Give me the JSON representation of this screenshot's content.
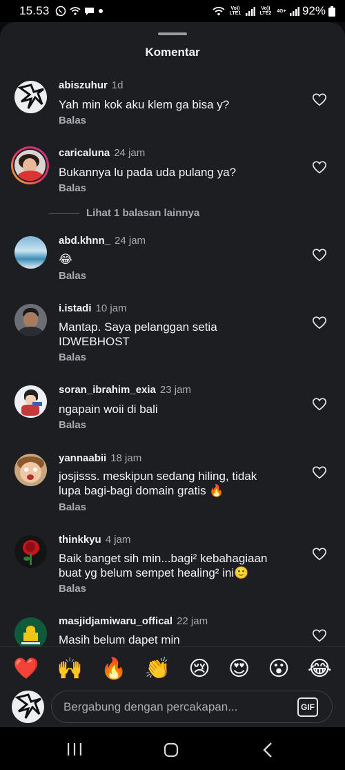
{
  "status": {
    "time": "15.53",
    "battery": "92%",
    "sim1": "Vo)) LTE1",
    "sim2": "Vo)) LTE2",
    "net": "4G+"
  },
  "sheet": {
    "title": "Komentar"
  },
  "reply_label": "Balas",
  "more_replies": "Lihat 1 balasan lainnya",
  "comments": [
    {
      "user": "abiszuhur",
      "time": "1d",
      "text": "Yah min kok aku klem ga bisa y?"
    },
    {
      "user": "caricaluna",
      "time": "24 jam",
      "text": "Bukannya lu pada uda pulang ya?"
    },
    {
      "user": "abd.khnn_",
      "time": "24 jam",
      "text": "😂"
    },
    {
      "user": "i.istadi",
      "time": "10 jam",
      "text": "Mantap. Saya pelanggan setia\nIDWEBHOST"
    },
    {
      "user": "soran_ibrahim_exia",
      "time": "23 jam",
      "text": "ngapain woii di bali"
    },
    {
      "user": "yannaabii",
      "time": "18 jam",
      "text": "josjisss. meskipun sedang hiling, tidak\nlupa bagi-bagi domain gratis 🔥"
    },
    {
      "user": "thinkkyu",
      "time": "4 jam",
      "text": "Baik banget sih min...bagi² kebahagiaan\nbuat yg belum sempet healing² ini🙂"
    },
    {
      "user": "masjidjamiwaru_offical",
      "time": "22 jam",
      "text": "Masih belum dapet min"
    }
  ],
  "emoji_reactions": [
    "❤️",
    "🙌",
    "🔥",
    "👏",
    "😢",
    "😍",
    "😮",
    "😂"
  ],
  "composer": {
    "placeholder": "Bergabung dengan percakapan...",
    "gif_label": "GIF"
  },
  "colors": {
    "sheet_bg": "#1c1e22",
    "text": "#f2f3f5",
    "muted": "#a8aab0",
    "story_ring": "#e1306c"
  }
}
